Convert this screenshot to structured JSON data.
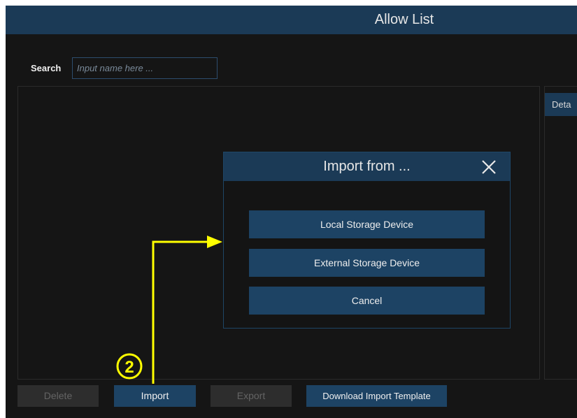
{
  "window": {
    "title": "Allow List"
  },
  "search": {
    "label": "Search",
    "placeholder": "Input name here ..."
  },
  "details": {
    "header": "Deta"
  },
  "toolbar": {
    "delete_label": "Delete",
    "import_label": "Import",
    "export_label": "Export",
    "template_label": "Download Import Template"
  },
  "dialog": {
    "title": "Import from ...",
    "close_icon": "close-icon",
    "options": [
      "Local Storage Device",
      "External Storage Device",
      "Cancel"
    ]
  },
  "annotation": {
    "step_number": "2",
    "color": "#ffff00"
  },
  "colors": {
    "title_bar": "#1b3a56",
    "button_active": "#1d4364",
    "button_disabled": "#2d2d2d",
    "background": "#151515"
  }
}
